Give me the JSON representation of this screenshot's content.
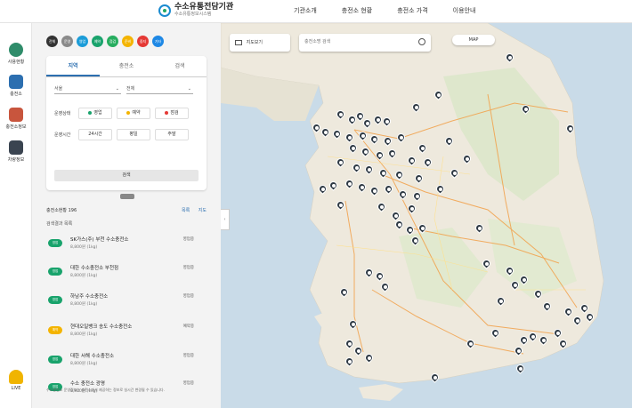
{
  "header": {
    "logo_title": "수소유통전담기관",
    "logo_sub": "수소유통정보시스템",
    "nav": [
      "기관소개",
      "충전소 현황",
      "충전소 가격",
      "이용안내"
    ]
  },
  "rail": [
    {
      "label": "사용현황",
      "icon": "globe-icon",
      "color": "#2f8c6a"
    },
    {
      "label": "충전소",
      "icon": "station-icon",
      "color": "#2c6fb0"
    },
    {
      "label": "충전소정보",
      "icon": "store-icon",
      "color": "#c8553d"
    },
    {
      "label": "차량정보",
      "icon": "car-icon",
      "color": "#3a4450"
    },
    {
      "label": "LIVE",
      "icon": "live-icon",
      "color": "#f0b400"
    }
  ],
  "filters": {
    "circles": [
      {
        "label": "전체",
        "color": "#333333"
      },
      {
        "label": "운영",
        "color": "#8a8a8a"
      },
      {
        "label": "영업",
        "color": "#1b9cd8"
      },
      {
        "label": "예약",
        "color": "#19a36c"
      },
      {
        "label": "점검",
        "color": "#27ad5f"
      },
      {
        "label": "준비",
        "color": "#f4b400"
      },
      {
        "label": "중지",
        "color": "#e53935"
      },
      {
        "label": "기타",
        "color": "#1e88e5"
      }
    ],
    "tabs": [
      "지역",
      "충전소",
      "검색"
    ],
    "region_select": "서울",
    "district_select": "전체",
    "status_label": "운영상태",
    "status_chips": [
      {
        "label": "영업",
        "dot_color": "#19a36c"
      },
      {
        "label": "예약",
        "dot_color": "#f4b400"
      },
      {
        "label": "점검",
        "dot_color": "#e53935"
      }
    ],
    "time_label": "운영시간",
    "time_chips": [
      "24시간",
      "평일",
      "주말"
    ],
    "search_label": "검색"
  },
  "results": {
    "count_text": "충전소현황 196",
    "links": [
      "목록",
      "지도"
    ],
    "sub_text": "검색결과 목록",
    "stations": [
      {
        "badge": "영업",
        "badge_color": "#19a36c",
        "name": "SK가스(주) 부천 수소충전소",
        "price": "8,800원 (1kg)",
        "stat": "영업중"
      },
      {
        "badge": "영업",
        "badge_color": "#19a36c",
        "name": "대한 수소충전소 부천점",
        "price": "8,800원 (1kg)",
        "stat": "영업중"
      },
      {
        "badge": "영업",
        "badge_color": "#19a36c",
        "name": "하남주 수소충전소",
        "price": "8,800원 (1kg)",
        "stat": "영업중"
      },
      {
        "badge": "예약",
        "badge_color": "#f4b400",
        "name": "현대오일뱅크 송도 수소충전소",
        "price": "8,800원 (1kg)",
        "stat": "예약중"
      },
      {
        "badge": "영업",
        "badge_color": "#19a36c",
        "name": "대한 서해 수소충전소",
        "price": "8,800원 (1kg)",
        "stat": "영업중"
      },
      {
        "badge": "영업",
        "badge_color": "#19a36c",
        "name": "수소 충전소 광명",
        "price": "8,800원 (1kg)",
        "stat": "영업중"
      }
    ],
    "notice": "수소충전소 운영정보는 충전소에서 제공하는 정보로 실시간 변경될 수 있습니다."
  },
  "map": {
    "search_placeholder": "충전소명 검색",
    "layer_label": "지도보기",
    "map_type": "MAP",
    "marker_count": 104
  }
}
